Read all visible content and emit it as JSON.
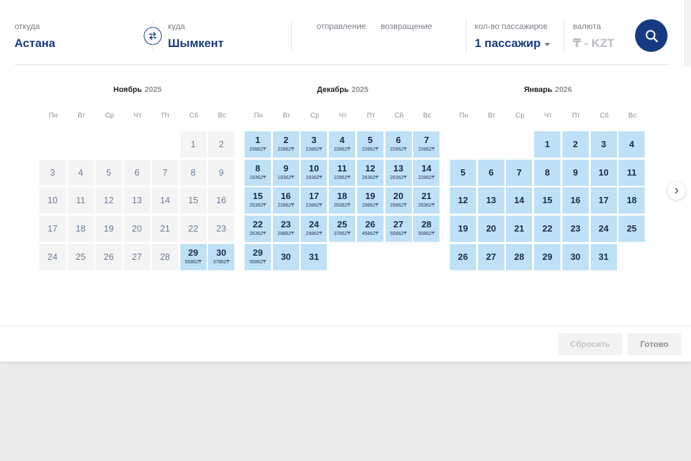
{
  "search": {
    "from_label": "откуда",
    "from_value": "Астана",
    "to_label": "куда",
    "to_value": "Шымкент",
    "departure_label": "отправление",
    "return_label": "возвращение",
    "passengers_label": "кол-во пассажиров",
    "passengers_value": "1 пассажир",
    "currency_label": "валюта",
    "currency_value": "₸ - KZT",
    "swap_icon": "swap-arrows-icon",
    "search_icon": "magnifier-icon"
  },
  "weekdays": [
    "Пн",
    "Вт",
    "Ср",
    "Чт",
    "Пт",
    "Сб",
    "Вс"
  ],
  "months": [
    {
      "name": "Ноябрь",
      "year": "2025",
      "first_weekday": 5,
      "days": [
        {
          "d": "1",
          "s": "past"
        },
        {
          "d": "2",
          "s": "past"
        },
        {
          "d": "3",
          "s": "past"
        },
        {
          "d": "4",
          "s": "past"
        },
        {
          "d": "5",
          "s": "past"
        },
        {
          "d": "6",
          "s": "past"
        },
        {
          "d": "7",
          "s": "past"
        },
        {
          "d": "8",
          "s": "past"
        },
        {
          "d": "9",
          "s": "past"
        },
        {
          "d": "10",
          "s": "past"
        },
        {
          "d": "11",
          "s": "past"
        },
        {
          "d": "12",
          "s": "past"
        },
        {
          "d": "13",
          "s": "past"
        },
        {
          "d": "14",
          "s": "past"
        },
        {
          "d": "15",
          "s": "past"
        },
        {
          "d": "16",
          "s": "past"
        },
        {
          "d": "17",
          "s": "past"
        },
        {
          "d": "18",
          "s": "past"
        },
        {
          "d": "19",
          "s": "past"
        },
        {
          "d": "20",
          "s": "past"
        },
        {
          "d": "21",
          "s": "past"
        },
        {
          "d": "22",
          "s": "past"
        },
        {
          "d": "23",
          "s": "past"
        },
        {
          "d": "24",
          "s": "past"
        },
        {
          "d": "25",
          "s": "past"
        },
        {
          "d": "26",
          "s": "past"
        },
        {
          "d": "27",
          "s": "past"
        },
        {
          "d": "28",
          "s": "past"
        },
        {
          "d": "29",
          "s": "avail",
          "p": "55862₸"
        },
        {
          "d": "30",
          "s": "avail",
          "p": "37862₸"
        }
      ]
    },
    {
      "name": "Декабрь",
      "year": "2025",
      "first_weekday": 0,
      "days": [
        {
          "d": "1",
          "s": "avail",
          "p": "29862₸"
        },
        {
          "d": "2",
          "s": "avail",
          "p": "22862₸"
        },
        {
          "d": "3",
          "s": "avail",
          "p": "22862₸"
        },
        {
          "d": "4",
          "s": "avail",
          "p": "22862₸"
        },
        {
          "d": "5",
          "s": "avail",
          "p": "22862₸"
        },
        {
          "d": "6",
          "s": "avail",
          "p": "22862₸"
        },
        {
          "d": "7",
          "s": "avail",
          "p": "22862₸"
        },
        {
          "d": "8",
          "s": "avail",
          "p": "19362₸"
        },
        {
          "d": "9",
          "s": "avail",
          "p": "19362₸"
        },
        {
          "d": "10",
          "s": "avail",
          "p": "19362₸"
        },
        {
          "d": "11",
          "s": "avail",
          "p": "22862₸"
        },
        {
          "d": "12",
          "s": "avail",
          "p": "26362₸"
        },
        {
          "d": "13",
          "s": "avail",
          "p": "26362₸"
        },
        {
          "d": "14",
          "s": "avail",
          "p": "22862₸"
        },
        {
          "d": "15",
          "s": "avail",
          "p": "26362₸"
        },
        {
          "d": "16",
          "s": "avail",
          "p": "22862₸"
        },
        {
          "d": "17",
          "s": "avail",
          "p": "22862₸"
        },
        {
          "d": "18",
          "s": "avail",
          "p": "26362₸"
        },
        {
          "d": "19",
          "s": "avail",
          "p": "29862₸"
        },
        {
          "d": "20",
          "s": "avail",
          "p": "29862₸"
        },
        {
          "d": "21",
          "s": "avail",
          "p": "26362₸"
        },
        {
          "d": "22",
          "s": "avail",
          "p": "26362₸"
        },
        {
          "d": "23",
          "s": "avail",
          "p": "29862₸"
        },
        {
          "d": "24",
          "s": "avail",
          "p": "29862₸"
        },
        {
          "d": "25",
          "s": "avail",
          "p": "37862₸"
        },
        {
          "d": "26",
          "s": "avail",
          "p": "45862₸"
        },
        {
          "d": "27",
          "s": "avail",
          "p": "55862₸"
        },
        {
          "d": "28",
          "s": "avail",
          "p": "55862₸"
        },
        {
          "d": "29",
          "s": "avail",
          "p": "55862₸"
        },
        {
          "d": "30",
          "s": "avail"
        },
        {
          "d": "31",
          "s": "avail"
        }
      ]
    },
    {
      "name": "Январь",
      "year": "2026",
      "first_weekday": 3,
      "days": [
        {
          "d": "1",
          "s": "avail"
        },
        {
          "d": "2",
          "s": "avail"
        },
        {
          "d": "3",
          "s": "avail"
        },
        {
          "d": "4",
          "s": "avail"
        },
        {
          "d": "5",
          "s": "avail"
        },
        {
          "d": "6",
          "s": "avail"
        },
        {
          "d": "7",
          "s": "avail"
        },
        {
          "d": "8",
          "s": "avail"
        },
        {
          "d": "9",
          "s": "avail"
        },
        {
          "d": "10",
          "s": "avail"
        },
        {
          "d": "11",
          "s": "avail"
        },
        {
          "d": "12",
          "s": "avail"
        },
        {
          "d": "13",
          "s": "avail"
        },
        {
          "d": "14",
          "s": "avail"
        },
        {
          "d": "15",
          "s": "avail"
        },
        {
          "d": "16",
          "s": "avail"
        },
        {
          "d": "17",
          "s": "avail"
        },
        {
          "d": "18",
          "s": "avail"
        },
        {
          "d": "19",
          "s": "avail"
        },
        {
          "d": "20",
          "s": "avail"
        },
        {
          "d": "21",
          "s": "avail"
        },
        {
          "d": "22",
          "s": "avail"
        },
        {
          "d": "23",
          "s": "avail"
        },
        {
          "d": "24",
          "s": "avail"
        },
        {
          "d": "25",
          "s": "avail"
        },
        {
          "d": "26",
          "s": "avail"
        },
        {
          "d": "27",
          "s": "avail"
        },
        {
          "d": "28",
          "s": "avail"
        },
        {
          "d": "29",
          "s": "avail"
        },
        {
          "d": "30",
          "s": "avail"
        },
        {
          "d": "31",
          "s": "avail"
        }
      ]
    }
  ],
  "next_month_icon": "chevron-right-icon",
  "footer": {
    "reset_label": "Сбросить",
    "done_label": "Готово"
  },
  "colors": {
    "brand": "#173b82",
    "available_day": "#bfe1f5",
    "past_day": "#f4f4f4"
  }
}
